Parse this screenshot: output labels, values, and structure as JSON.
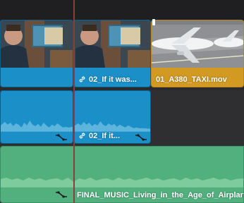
{
  "timeline": {
    "video_track": {
      "clips": [
        {
          "label": ""
        },
        {
          "label": "02_If it was..."
        },
        {
          "label": "01_A380_TAXI.mov"
        }
      ]
    },
    "audio_track_1": {
      "clips": [
        {
          "label": ""
        },
        {
          "label": "02_If it..."
        }
      ]
    },
    "music_track": {
      "clip": {
        "label": "FINAL_MUSIC_Living_in_the_Age_of_Airplanes"
      }
    },
    "colors": {
      "video_clip": "#1a8fc8",
      "selected_clip": "#d29a22",
      "music_clip": "#52b07f",
      "playhead": "#8e3b3f"
    },
    "icons": [
      "link-icon",
      "volume-curve-icon"
    ]
  }
}
